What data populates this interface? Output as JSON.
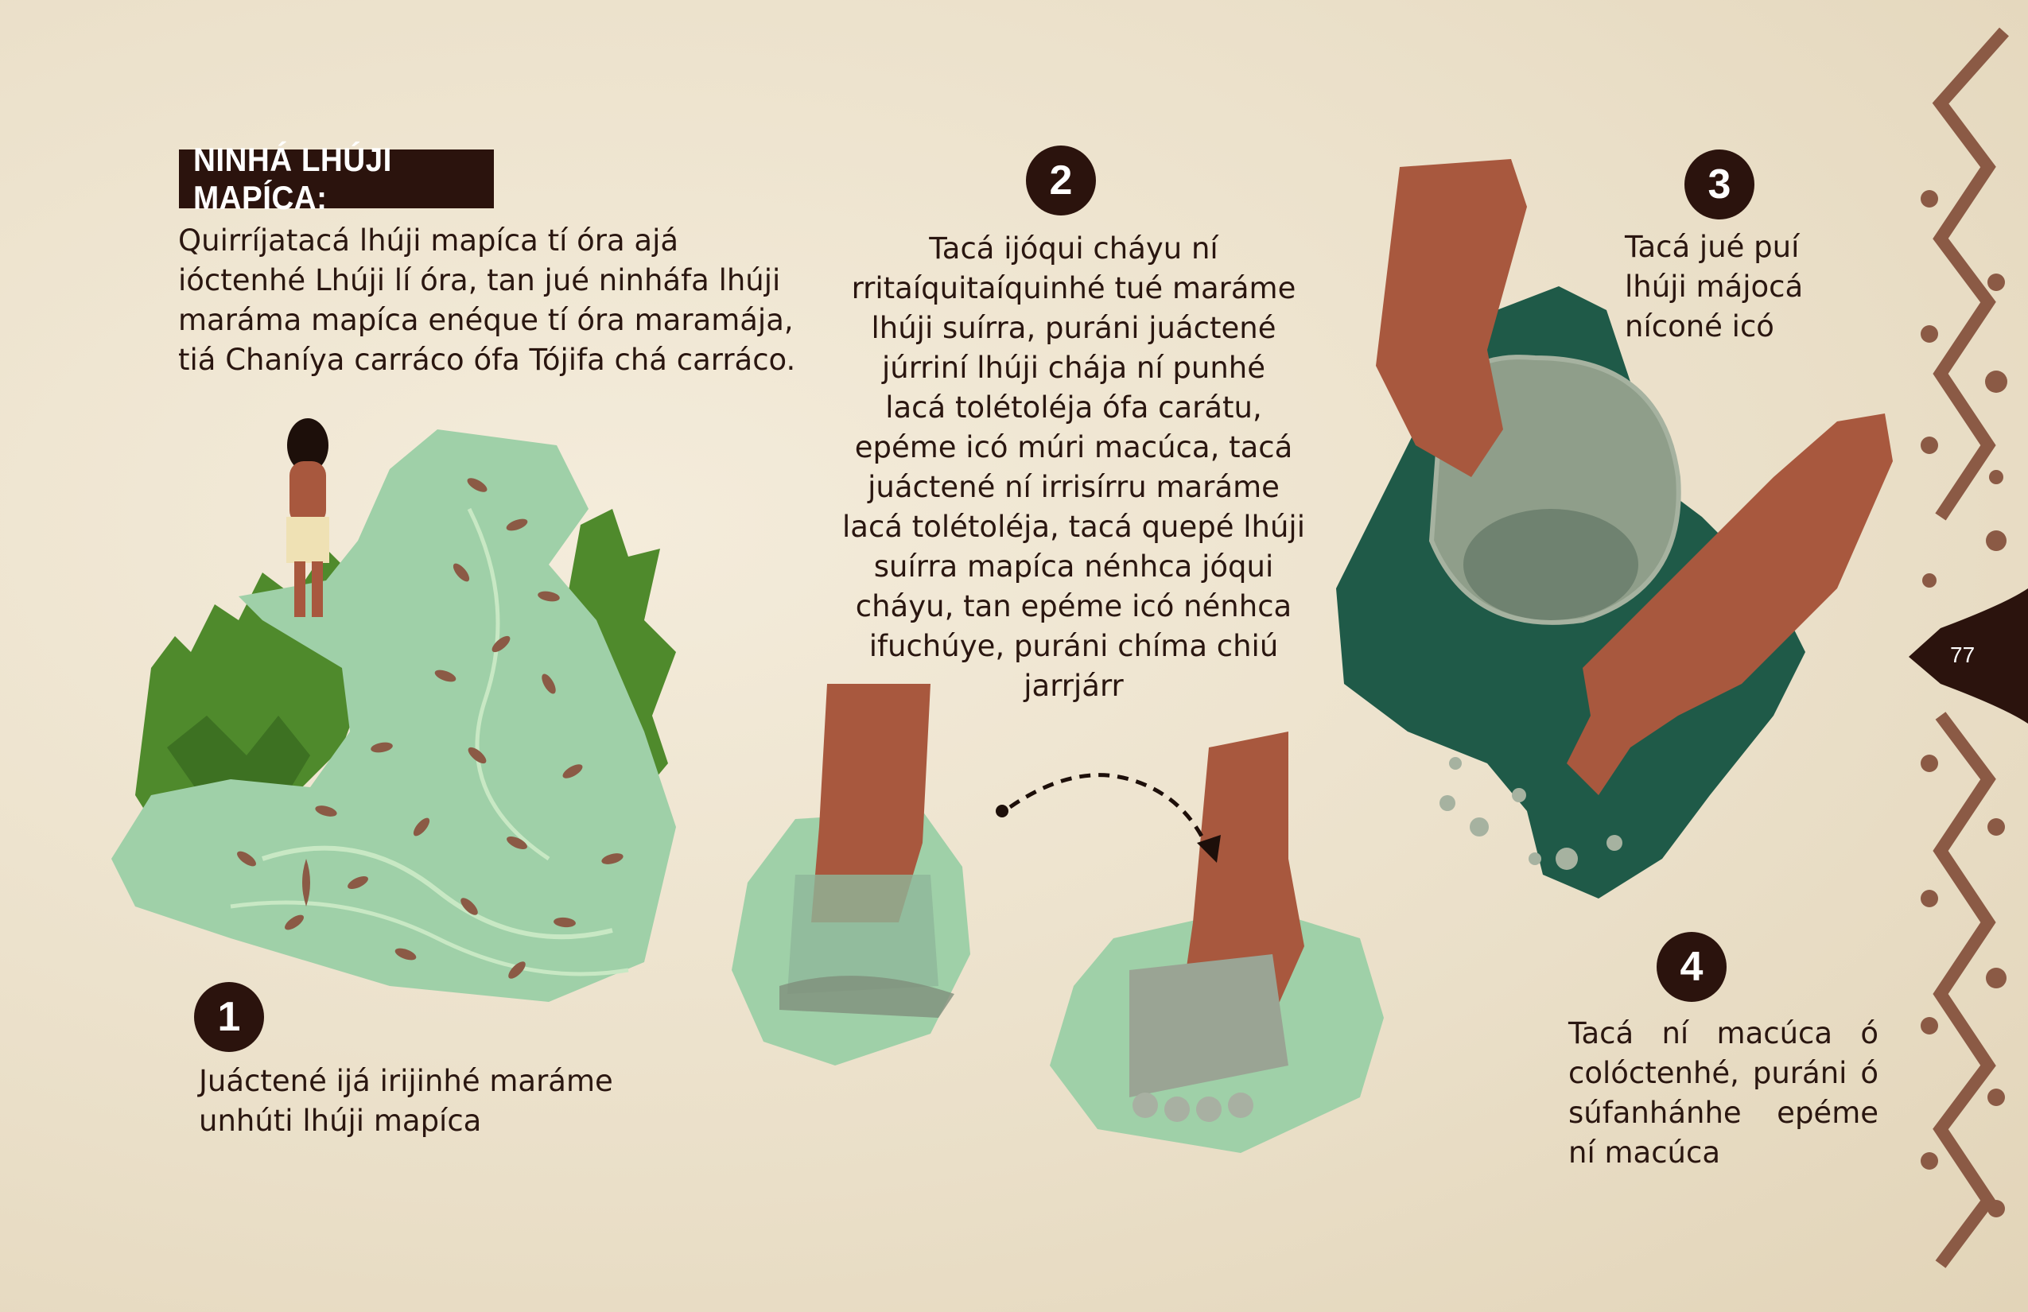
{
  "page": {
    "title": "NINHÁ LHÚJI MAPÍCA:",
    "intro_lines": [
      "Quirríjatacá lhúji mapíca tí óra ajá",
      "ióctenhé Lhúji lí óra, tan jué ninháfa lhúji",
      "maráma mapíca enéque tí óra maramája,",
      "tiá Chaníya carráco ófa Tójifa chá carráco."
    ],
    "page_number": "77"
  },
  "steps": [
    {
      "number": "1",
      "lines": [
        "Juáctené ijá irijinhé maráme",
        "unhúti lhúji mapíca"
      ]
    },
    {
      "number": "2",
      "lines": [
        "Tacá ijóqui cháyu ní",
        "rritaíquitaíquinhé tué maráme",
        "lhúji suírra, puráni juáctené",
        "júrriní lhúji chája ní punhé",
        "lacá tolétoléja ófa carátu,",
        "epéme icó múri macúca, tacá",
        "juáctené ní irrisírru maráme",
        "lacá tolétoléja, tacá quepé lhúji",
        "suírra mapíca nénhca jóqui",
        "cháyu, tan epéme icó nénhca",
        "ifuchúye, puráni chíma chiú",
        "jarrjárr"
      ]
    },
    {
      "number": "3",
      "lines": [
        "Tacá jué puí",
        "lhúji májocá",
        "níconé icó"
      ]
    },
    {
      "number": "4",
      "lines": [
        "Tacá ní macúca ó",
        "colóctenhé, puráni ó",
        "súfanhánhe epéme",
        "ní macúca"
      ]
    }
  ],
  "colors": {
    "paper": "#efe6d3",
    "dark_brown": "#2b130d",
    "water_green": "#9fd0a8",
    "forest_green": "#4f8a2c",
    "deep_teal": "#1f5a48",
    "skin": "#a8583e",
    "clay_grey": "#8f9e8a",
    "border_brown": "#8b5a45"
  },
  "icons": [
    "dotted-arrow-icon",
    "zigzag-border-icon"
  ]
}
